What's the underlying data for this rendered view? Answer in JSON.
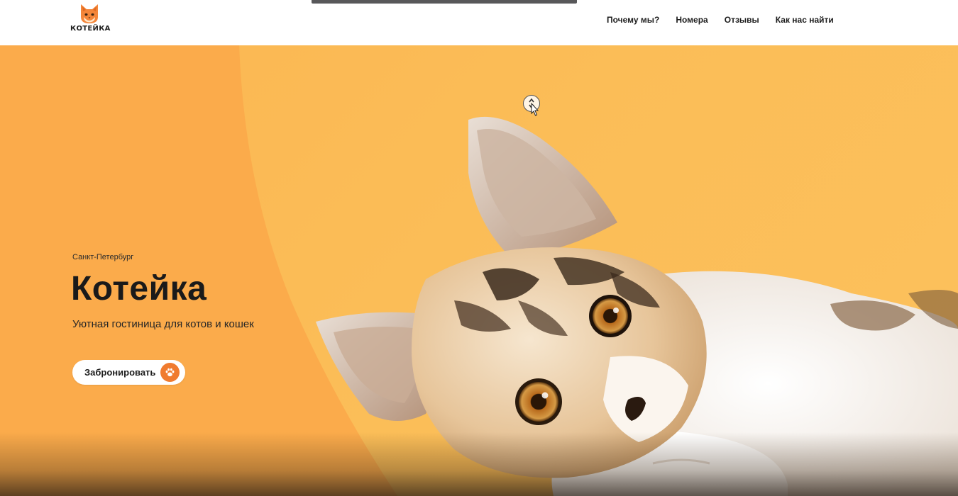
{
  "header": {
    "logo_text": "КОТЕЙКА",
    "nav": [
      {
        "label": "Почему мы?"
      },
      {
        "label": "Номера"
      },
      {
        "label": "Отзывы"
      },
      {
        "label": "Как нас найти"
      }
    ]
  },
  "hero": {
    "city": "Санкт-Петербург",
    "title": "Котейка",
    "subtitle": "Уютная гостиница для котов и кошек",
    "cta_label": "Забронировать",
    "cta_icon": "paw-icon",
    "image": "kitten-photo"
  },
  "colors": {
    "accent": "#f07b2f",
    "hero_left": "#fbab4b",
    "hero_right": "#fcc15d",
    "text": "#1a1a1a"
  }
}
